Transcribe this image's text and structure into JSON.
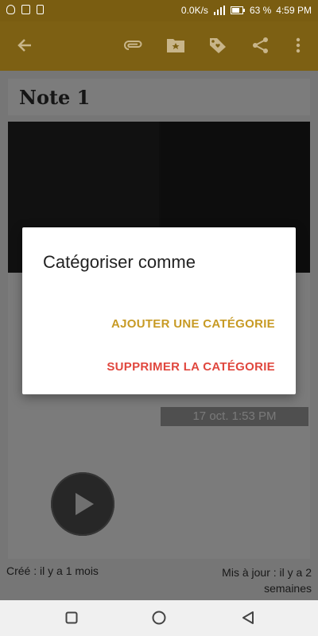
{
  "status_bar": {
    "network_speed": "0.0K/s",
    "battery": "63 %",
    "time": "4:59 PM"
  },
  "toolbar": {
    "icons": [
      "back-arrow-icon",
      "attachment-icon",
      "folder-star-icon",
      "tag-icon",
      "share-icon",
      "more-vert-icon"
    ]
  },
  "note": {
    "title": "Note 1",
    "date": "17 oct. 1:53 PM",
    "created": "Créé : il y a 1 mois",
    "updated": "Mis à jour : il y a 2 semaines"
  },
  "dialog": {
    "title": "Catégoriser comme",
    "add_label": "AJOUTER UNE CATÉGORIE",
    "remove_label": "SUPPRIMER LA CATÉGORIE"
  },
  "colors": {
    "toolbar": "#7d6013",
    "add_button": "#c79a24",
    "remove_button": "#e0473e"
  }
}
